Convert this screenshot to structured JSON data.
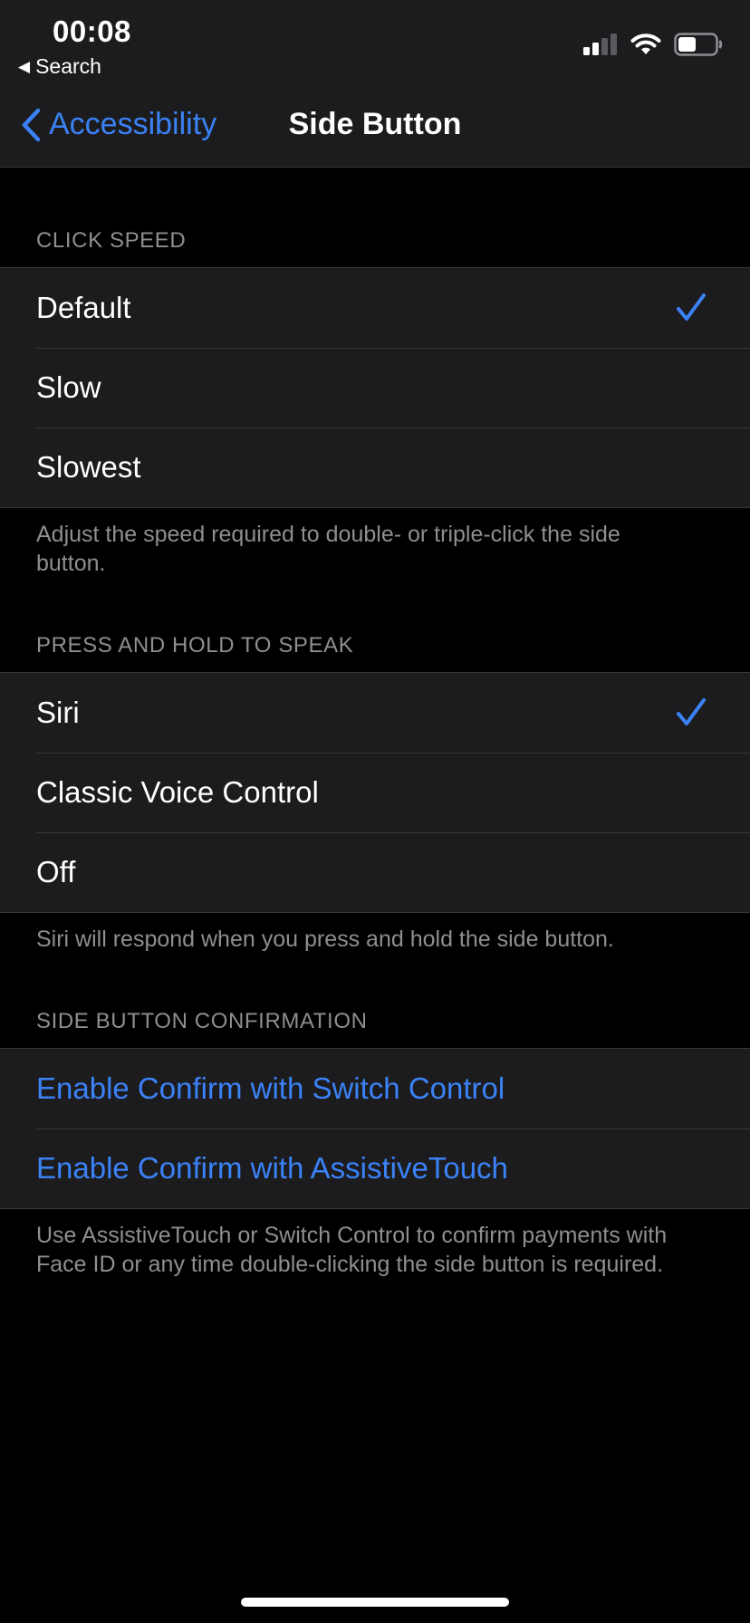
{
  "status_bar": {
    "time": "00:08",
    "back_app": "Search"
  },
  "nav": {
    "back_label": "Accessibility",
    "title": "Side Button"
  },
  "sections": {
    "click_speed": {
      "header": "CLICK SPEED",
      "options": [
        "Default",
        "Slow",
        "Slowest"
      ],
      "selected": "Default",
      "footer": "Adjust the speed required to double- or triple-click the side button."
    },
    "press_hold": {
      "header": "PRESS AND HOLD TO SPEAK",
      "options": [
        "Siri",
        "Classic Voice Control",
        "Off"
      ],
      "selected": "Siri",
      "footer": "Siri will respond when you press and hold the side button."
    },
    "confirmation": {
      "header": "SIDE BUTTON CONFIRMATION",
      "links": [
        "Enable Confirm with Switch Control",
        "Enable Confirm with AssistiveTouch"
      ],
      "footer": "Use AssistiveTouch or Switch Control to confirm payments with Face ID or any time double-clicking the side button is required."
    }
  },
  "colors": {
    "accent": "#3b82f6",
    "background": "#000000",
    "cell": "#1c1c1e",
    "secondary_text": "#8e8e93"
  },
  "icons": {
    "back_triangle": "back-triangle-icon",
    "nav_back": "chevron-left-icon",
    "signal": "cellular-signal-icon",
    "wifi": "wifi-icon",
    "battery": "battery-icon",
    "check": "checkmark-icon"
  }
}
